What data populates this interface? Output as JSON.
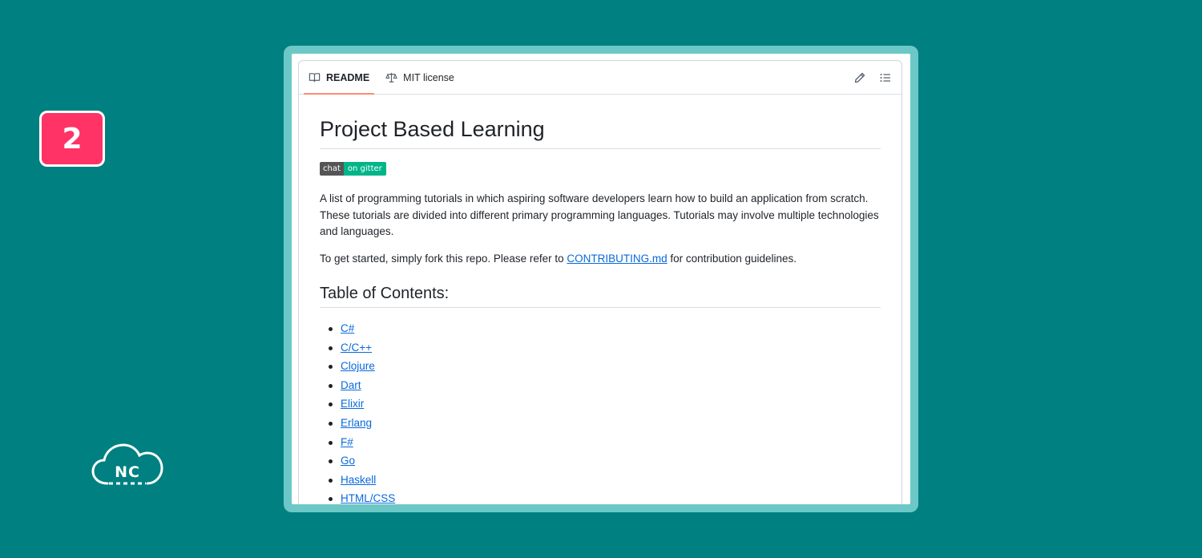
{
  "badge": {
    "number": "2"
  },
  "logo": {
    "text": "NC"
  },
  "tabs": [
    {
      "label": "README",
      "icon": "book-icon",
      "active": true
    },
    {
      "label": "MIT license",
      "icon": "scale-icon",
      "active": false
    }
  ],
  "actions": {
    "edit_icon": "pencil-icon",
    "outline_icon": "list-icon"
  },
  "readme": {
    "title": "Project Based Learning",
    "gitter": {
      "left": "chat",
      "right": "on gitter"
    },
    "intro": "A list of programming tutorials in which aspiring software developers learn how to build an application from scratch. These tutorials are divided into different primary programming languages. Tutorials may involve multiple technologies and languages.",
    "getting_started": {
      "before": "To get started, simply fork this repo. Please refer to ",
      "link": "CONTRIBUTING.md",
      "after": " for contribution guidelines."
    },
    "toc_title": "Table of Contents:",
    "toc": [
      "C#",
      "C/C++",
      "Clojure",
      "Dart",
      "Elixir",
      "Erlang",
      "F#",
      "Go",
      "Haskell",
      "HTML/CSS"
    ]
  },
  "colors": {
    "background": "#008080",
    "frame": "#6cc8c6",
    "badge": "#ff3366",
    "link": "#0969da",
    "active_tab_underline": "#fd8c73"
  }
}
